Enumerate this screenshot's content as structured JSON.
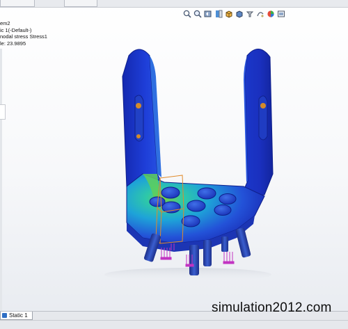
{
  "info": {
    "line1": "em2",
    "line2": "ic 1(-Default-)",
    "line3": "nodal stress Stress1",
    "line4": "le: 23.9895"
  },
  "toolbar": {
    "icons": [
      "zoom-to-fit-icon",
      "zoom-area-icon",
      "previous-view-icon",
      "section-view-icon",
      "view-orientation-icon",
      "display-style-icon",
      "hide-show-icon",
      "edit-appearance-icon",
      "scene-icon",
      "view-settings-icon"
    ]
  },
  "bottom": {
    "tab_label": "Static 1"
  },
  "watermark": "simulation2012.com",
  "colors": {
    "stress_low": "#1a33c8",
    "stress_mid": "#1fb6c8",
    "stress_high": "#7ad24a",
    "load_arrows": "#c233c2"
  }
}
